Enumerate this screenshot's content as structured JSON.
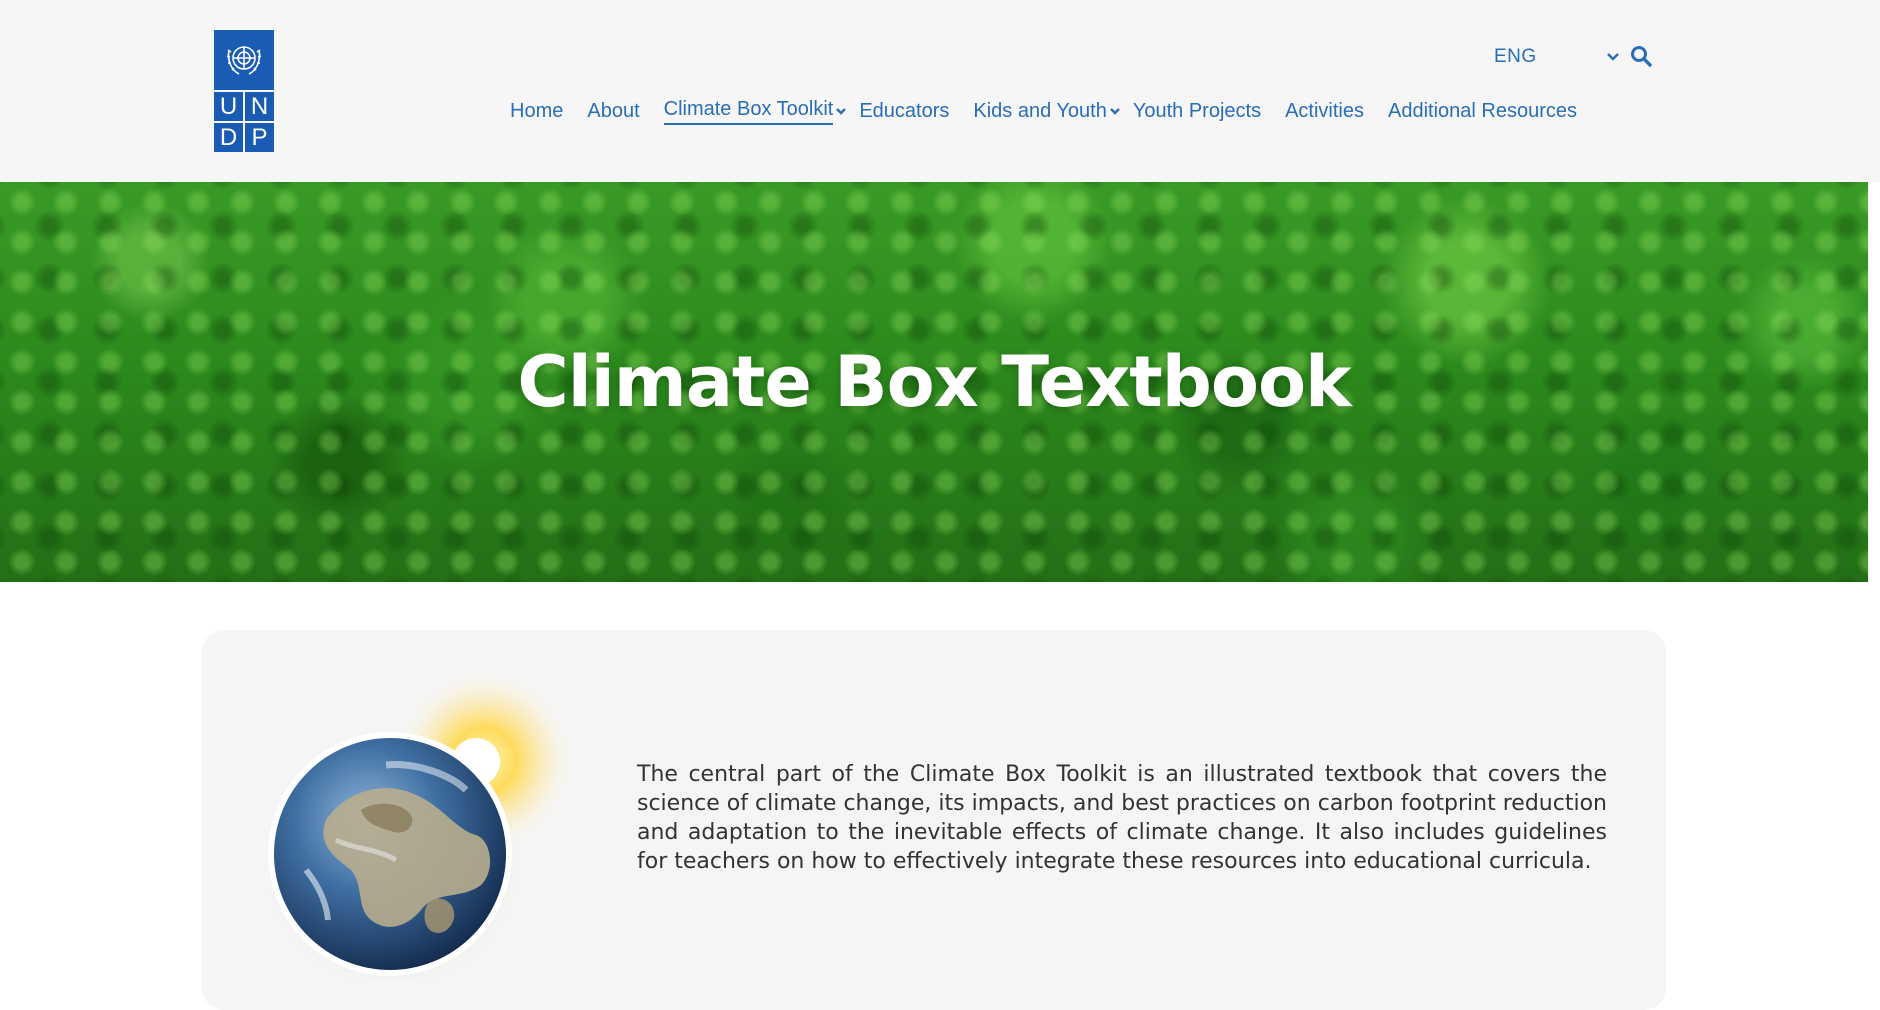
{
  "header": {
    "logo": {
      "letters": [
        "U",
        "N",
        "D",
        "P"
      ],
      "icon": "un-emblem-icon",
      "color": "#1a5cb4"
    },
    "language": {
      "selected": "ENG",
      "icon": "chevron-down-icon"
    },
    "search_icon": "search-icon",
    "nav": {
      "items": [
        {
          "label": "Home"
        },
        {
          "label": "About"
        },
        {
          "label": "Climate Box Toolkit",
          "active": true,
          "dropdown": true
        },
        {
          "label": "Educators"
        },
        {
          "label": "Kids and Youth",
          "dropdown": true
        },
        {
          "label": "Youth Projects"
        },
        {
          "label": "Activities"
        },
        {
          "label": "Additional Resources"
        }
      ]
    },
    "link_color": "#2a6db7"
  },
  "hero": {
    "title": "Climate Box Textbook"
  },
  "content": {
    "description": "The central part of the Climate Box Toolkit is an illustrated textbook that covers the science of climate change, its impacts, and best practices on carbon footprint reduction and adaptation to the inevitable effects of climate change. It also includes guidelines for teachers on how to effectively integrate these resources into educational curricula.",
    "illustration": "earth-with-sun-icon"
  }
}
